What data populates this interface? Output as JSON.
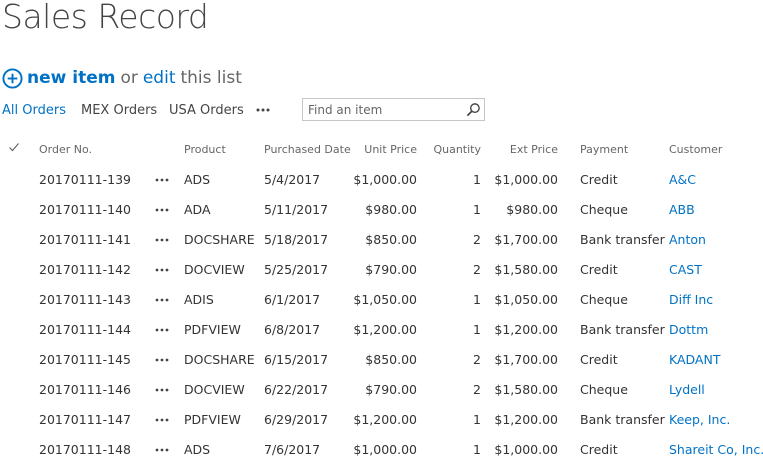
{
  "page": {
    "title": "Sales Record"
  },
  "toolbar": {
    "new_item": "new item",
    "or": "or",
    "edit": "edit",
    "this_list": "this list"
  },
  "views": {
    "tabs": [
      "All Orders",
      "MEX Orders",
      "USA Orders"
    ],
    "active": "All Orders"
  },
  "search": {
    "placeholder": "Find an item"
  },
  "table": {
    "columns": [
      "Order No.",
      "Product",
      "Purchased Date",
      "Unit Price",
      "Quantity",
      "Ext Price",
      "Payment",
      "Customer"
    ],
    "rows": [
      [
        "20170111-139",
        "ADS",
        "5/4/2017",
        "$1,000.00",
        "1",
        "$1,000.00",
        "Credit",
        "A&C"
      ],
      [
        "20170111-140",
        "ADA",
        "5/11/2017",
        "$980.00",
        "1",
        "$980.00",
        "Cheque",
        "ABB"
      ],
      [
        "20170111-141",
        "DOCSHARE",
        "5/18/2017",
        "$850.00",
        "2",
        "$1,700.00",
        "Bank transfer",
        "Anton"
      ],
      [
        "20170111-142",
        "DOCVIEW",
        "5/25/2017",
        "$790.00",
        "2",
        "$1,580.00",
        "Credit",
        "CAST"
      ],
      [
        "20170111-143",
        "ADIS",
        "6/1/2017",
        "$1,050.00",
        "1",
        "$1,050.00",
        "Cheque",
        "Diff Inc"
      ],
      [
        "20170111-144",
        "PDFVIEW",
        "6/8/2017",
        "$1,200.00",
        "1",
        "$1,200.00",
        "Bank transfer",
        "Dottm"
      ],
      [
        "20170111-145",
        "DOCSHARE",
        "6/15/2017",
        "$850.00",
        "2",
        "$1,700.00",
        "Credit",
        "KADANT"
      ],
      [
        "20170111-146",
        "DOCVIEW",
        "6/22/2017",
        "$790.00",
        "2",
        "$1,580.00",
        "Cheque",
        "Lydell"
      ],
      [
        "20170111-147",
        "PDFVIEW",
        "6/29/2017",
        "$1,200.00",
        "1",
        "$1,200.00",
        "Bank transfer",
        "Keep, Inc."
      ],
      [
        "20170111-148",
        "ADS",
        "7/6/2017",
        "$1,000.00",
        "1",
        "$1,000.00",
        "Credit",
        "Shareit Co, Inc."
      ]
    ]
  },
  "icons": {
    "plus": "plus-circle-icon",
    "more": "ellipsis-icon",
    "search": "search-icon",
    "select_all": "checkmark-icon",
    "item_menu": "ellipsis-icon"
  },
  "colors": {
    "accent": "#0072c6",
    "title": "#444444",
    "muted": "#666666",
    "text": "#333333"
  }
}
